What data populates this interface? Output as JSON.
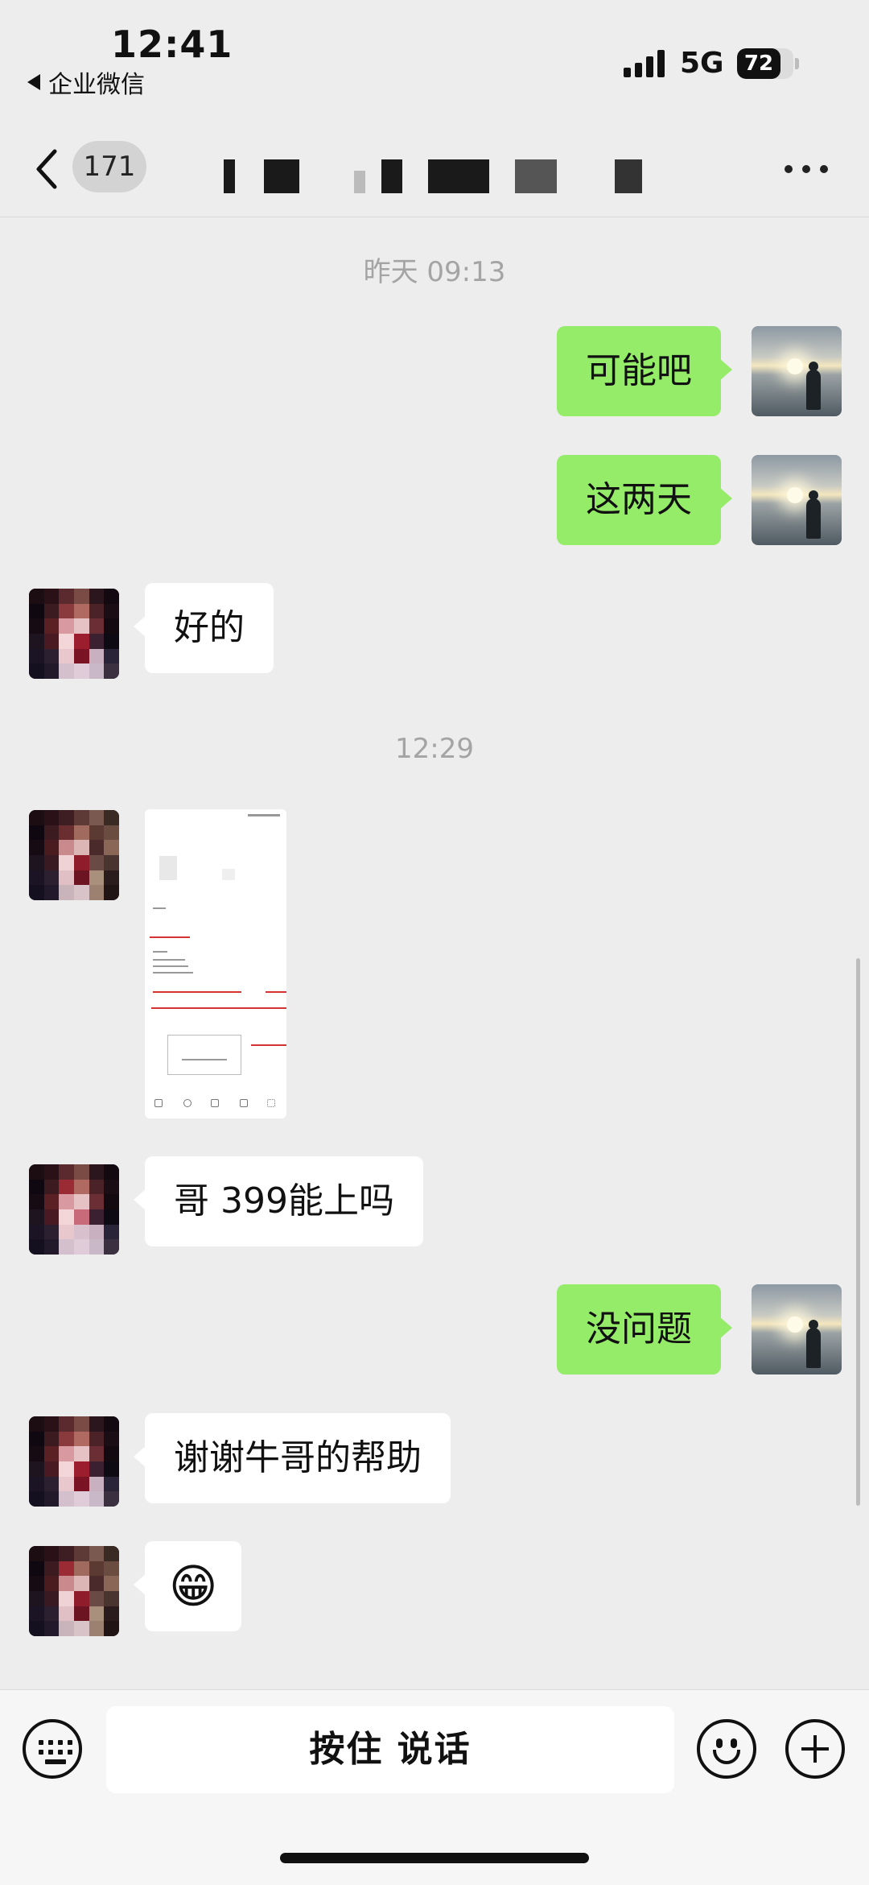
{
  "status_bar": {
    "time": "12:41",
    "back_app": "企业微信",
    "network": "5G",
    "battery": "72",
    "battery_level": 0.72
  },
  "nav": {
    "unread_count": "171",
    "back_icon": "chevron-left-icon",
    "more_icon": "more-dots-icon"
  },
  "messages": {
    "ts1": "昨天 09:13",
    "m1": "可能吧",
    "m2": "这两天",
    "m3": "好的",
    "ts2": "12:29",
    "m5": "哥 399能上吗",
    "m6": "没问题",
    "m7": "谢谢牛哥的帮助",
    "m8": "😁"
  },
  "input_bar": {
    "hold_to_talk": "按住 说话",
    "keyboard_icon": "keyboard-icon",
    "emoji_icon": "smile-icon",
    "plus_icon": "plus-icon"
  },
  "colors": {
    "background": "#ededed",
    "my_bubble": "#95ec69",
    "other_bubble": "#ffffff",
    "timestamp_text": "#a4a4a4"
  }
}
